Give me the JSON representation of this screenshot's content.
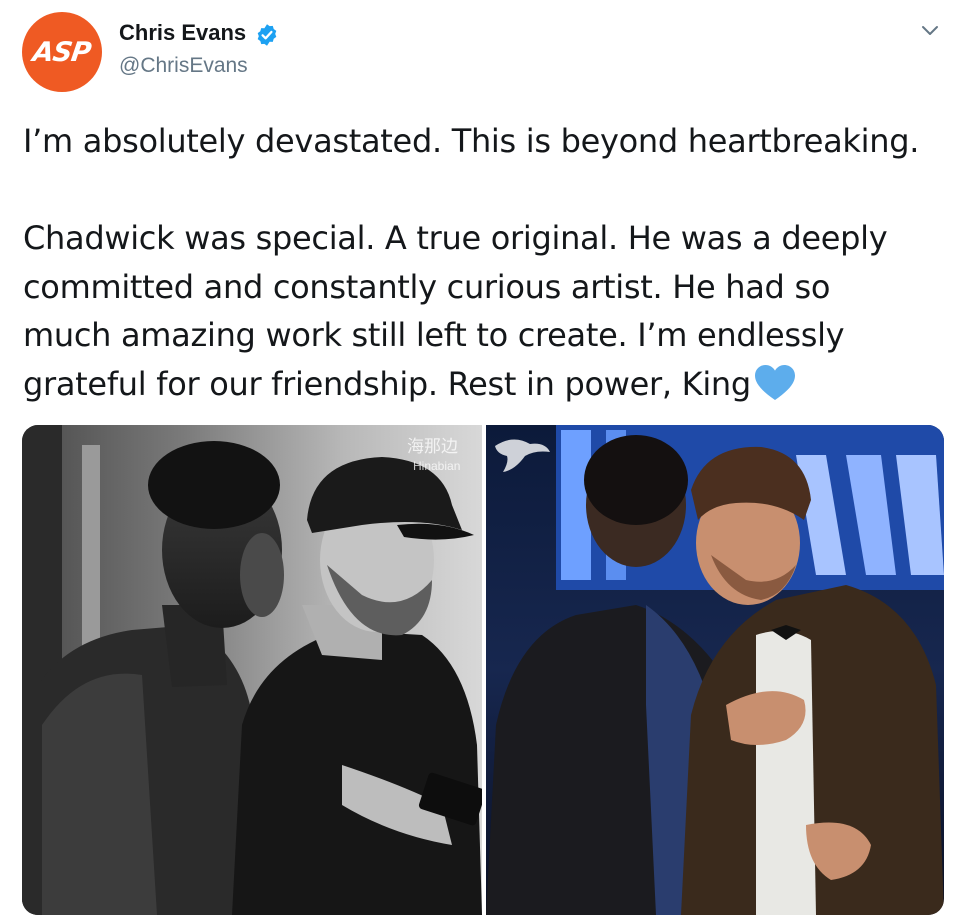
{
  "tweet": {
    "avatar_text": "ASP",
    "display_name": "Chris Evans",
    "handle": "@ChrisEvans",
    "verified_icon": "verified-badge-icon",
    "menu_icon": "chevron-down-icon",
    "text": {
      "line1": "I’m absolutely devastated. This is beyond heartbreaking.",
      "line2": "Chadwick was special. A true original. He was a deeply",
      "line3": "committed and constantly curious artist. He had so",
      "line4": "much amazing work still left to create. I’m endlessly",
      "line5": "grateful for our friendship. Rest in power, King"
    },
    "emoji_icon": "blue-heart-icon"
  },
  "watermark": {
    "chinese": "海那边",
    "latin": "Hinabian"
  },
  "colors": {
    "avatar_bg": "#ef5a23",
    "verified_blue": "#1da1f2",
    "heart_blue": "#5dadec",
    "handle_gray": "#657786"
  }
}
